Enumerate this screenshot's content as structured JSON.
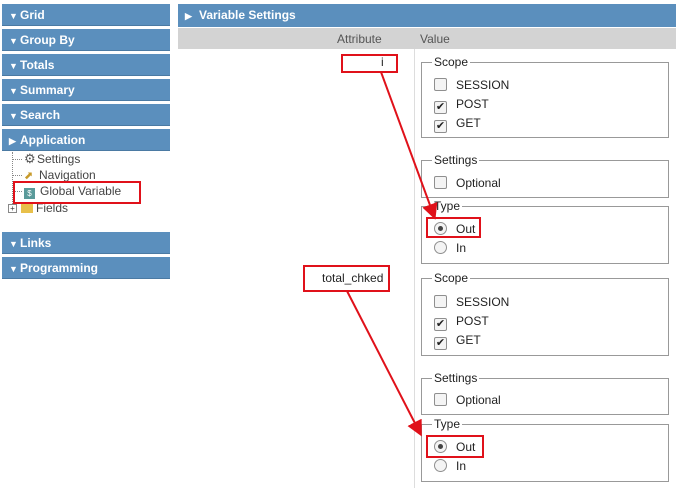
{
  "sidebar": {
    "sections_top": [
      "Grid",
      "Group By",
      "Totals",
      "Summary",
      "Search",
      "Application"
    ],
    "tree": {
      "settings": "Settings",
      "navigation": "Navigation",
      "global_variable": "Global Variable",
      "global_variable_icon_text": "$",
      "fields": "Fields"
    },
    "sections_bottom": [
      "Links",
      "Programming"
    ]
  },
  "main": {
    "title": "Variable Settings",
    "columns": {
      "attribute": "Attribute",
      "value": "Value"
    },
    "variables": [
      {
        "name": "i",
        "scope_legend": "Scope",
        "scope": [
          {
            "label": "SESSION",
            "checked": false
          },
          {
            "label": "POST",
            "checked": true
          },
          {
            "label": "GET",
            "checked": true
          }
        ],
        "settings_legend": "Settings",
        "optional_label": "Optional",
        "optional_checked": false,
        "type_legend": "Type",
        "type_out": "Out",
        "type_in": "In",
        "type_selected": "Out"
      },
      {
        "name": "total_chked",
        "scope_legend": "Scope",
        "scope": [
          {
            "label": "SESSION",
            "checked": false
          },
          {
            "label": "POST",
            "checked": true
          },
          {
            "label": "GET",
            "checked": true
          }
        ],
        "settings_legend": "Settings",
        "optional_label": "Optional",
        "optional_checked": false,
        "type_legend": "Type",
        "type_out": "Out",
        "type_in": "In",
        "type_selected": "Out"
      }
    ]
  },
  "icons": {
    "section_arrow": "triangle-down-icon",
    "header_arrow": "triangle-right-icon",
    "settings": "gear-icon",
    "navigation": "arrow-icon",
    "global_variable": "dollar-icon",
    "fields": "folder-icon",
    "expand": "plus-icon",
    "checkmark": "✔"
  },
  "colors": {
    "section_header": "#5b8fbd",
    "column_header": "#d3d3d3",
    "annotation": "#e0111a"
  }
}
